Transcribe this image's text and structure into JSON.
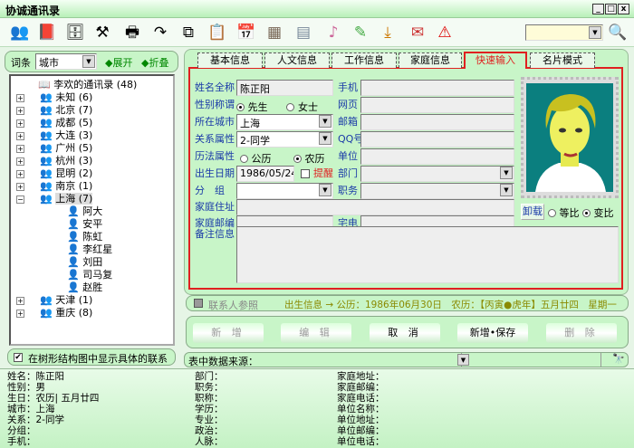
{
  "window": {
    "title": "协诚通讯录",
    "minimize": "_",
    "maximize": "□",
    "close": "x"
  },
  "toolbar": {
    "icons": [
      "contacts-icon",
      "book-icon",
      "cabinet-icon",
      "tools-icon",
      "printer-icon",
      "redo-icon",
      "copy-icon",
      "paste-icon",
      "calendar-icon",
      "texture-icon",
      "calculator-icon",
      "music-icon",
      "pen-icon",
      "download-icon",
      "sign-icon",
      "warning-icon"
    ],
    "search_value": ""
  },
  "left": {
    "filter_label": "词条",
    "filter_value": "城市",
    "expand": "◆展开",
    "collapse": "◆折叠",
    "tree": {
      "root": "李欢的通讯录 (48)",
      "groups": [
        {
          "label": "未知 (6)"
        },
        {
          "label": "北京 (7)"
        },
        {
          "label": "成都 (5)"
        },
        {
          "label": "大连 (3)"
        },
        {
          "label": "广州 (5)"
        },
        {
          "label": "杭州 (3)"
        },
        {
          "label": "昆明 (2)"
        },
        {
          "label": "南京 (1)"
        },
        {
          "label": "上海 (7)",
          "expanded": true,
          "children": [
            "阿大",
            "安平",
            "陈虹",
            "李红星",
            "刘田",
            "司马复",
            "赵胜"
          ]
        },
        {
          "label": "天津 (1)"
        },
        {
          "label": "重庆 (8)"
        }
      ]
    },
    "show_contacts_label": "在树形结构图中显示具体的联系人",
    "show_contacts_checked": true
  },
  "tabs": [
    "基本信息",
    "人文信息",
    "工作信息",
    "家庭信息",
    "快速输入",
    "名片模式"
  ],
  "active_tab": "快速输入",
  "form": {
    "name_label": "姓名全称",
    "name": "陈正阳",
    "gender_label": "性别称谓",
    "gender_male": "先生",
    "gender_female": "女士",
    "gender": "先生",
    "city_label": "所在城市",
    "city": "上海",
    "relation_label": "关系属性",
    "relation": "2-同学",
    "calendar_label": "历法属性",
    "cal_solar": "公历",
    "cal_lunar": "农历",
    "calendar": "农历",
    "birth_label": "出生日期",
    "birth": "1986/05/24",
    "remind": "提醒",
    "group_label": "分　组",
    "group": "",
    "home_addr_label": "家庭住址",
    "home_addr": "",
    "home_zip_label": "家庭邮编",
    "home_zip": "",
    "mobile_label": "手机",
    "web_label": "网页",
    "email_label": "邮箱",
    "qq_label": "QQ号",
    "company_label": "单位",
    "dept_label": "部门",
    "title_label": "职务",
    "home_phone_label": "宅电",
    "unload": "卸载",
    "ratio_fixed": "等比",
    "ratio_free": "变比",
    "ratio": "变比",
    "notes_label": "备注信息",
    "notes": ""
  },
  "infobar": {
    "contact_ref": "联系人参照",
    "birth_info": "出生信息 → 公历：1986年06月30日　农历：【丙寅●虎年】五月廿四　星期一"
  },
  "buttons": {
    "new": "新 增",
    "edit": "编 辑",
    "cancel": "取 消",
    "new_save": "新增•保存",
    "delete": "删 除"
  },
  "datasource": {
    "label": "表中数据来源：",
    "value": ""
  },
  "summary": {
    "col1": [
      "姓名：陈正阳",
      "性别：男",
      "生日：农历| 五月廿四",
      "城市：上海",
      "关系：2-同学",
      "分组：",
      "手机："
    ],
    "col2": [
      "部门：",
      "职务：",
      "职称：",
      "学历：",
      "专业：",
      "政治：",
      "人脉："
    ],
    "col3": [
      "家庭地址：",
      "家庭邮编：",
      "家庭电话：",
      "单位名称：",
      "单位地址：",
      "单位邮编：",
      "单位电话："
    ]
  },
  "colors": {
    "accent_red": "#e02020",
    "label_blue": "#1a3aa8",
    "panel_green": "#c8f5c8",
    "info_olive": "#8a8a00"
  }
}
